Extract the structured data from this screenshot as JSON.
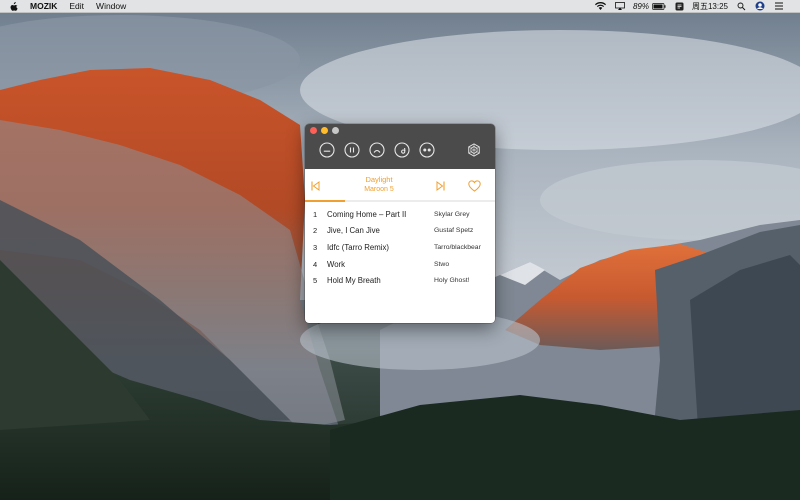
{
  "menubar": {
    "app_name": "MOZIK",
    "menus": [
      "Edit",
      "Window"
    ],
    "battery_percent": "89%",
    "clock": "周五13:25",
    "icons": [
      "apple-icon",
      "wifi-icon",
      "airplay-icon",
      "battery-icon",
      "app-status-icon",
      "search-icon",
      "user-icon",
      "list-icon"
    ]
  },
  "player": {
    "moods": [
      "neutral-face-icon",
      "pause-face-icon",
      "sad-face-icon",
      "wink-face-icon",
      "shades-face-icon"
    ],
    "now_playing": {
      "title": "Daylight",
      "artist": "Maroon 5",
      "progress": 0.21
    },
    "tracks": [
      {
        "num": "1",
        "title": "Coming Home – Part II",
        "artist": "Skylar Grey"
      },
      {
        "num": "2",
        "title": "Jive, I Can Jive",
        "artist": "Gustaf Spetz"
      },
      {
        "num": "3",
        "title": "Idfc (Tarro Remix)",
        "artist": "Tarro/blackbear"
      },
      {
        "num": "4",
        "title": "Work",
        "artist": "Stwo"
      },
      {
        "num": "5",
        "title": "Hold My Breath",
        "artist": "Holy Ghost!"
      }
    ],
    "accent_color": "#f0a030",
    "toolbar_color": "#4b4b4b"
  }
}
